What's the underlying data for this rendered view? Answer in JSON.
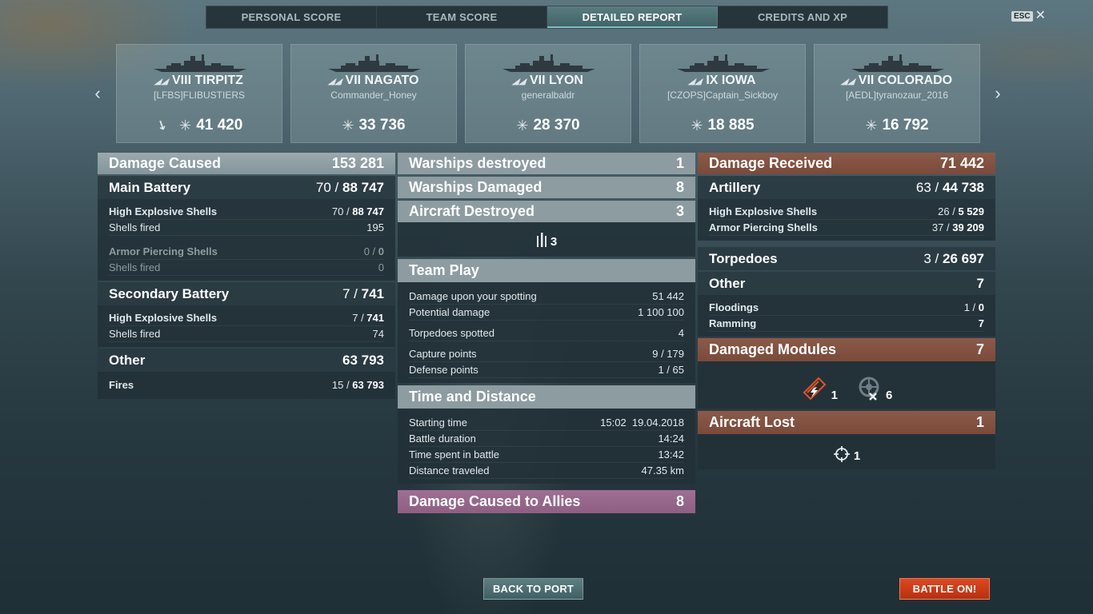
{
  "tabs": [
    {
      "label": "PERSONAL SCORE",
      "active": false
    },
    {
      "label": "TEAM SCORE",
      "active": false
    },
    {
      "label": "DETAILED REPORT",
      "active": true
    },
    {
      "label": "CREDITS AND XP",
      "active": false
    }
  ],
  "esc": {
    "key": "ESC",
    "close": "✕"
  },
  "nav": {
    "prev": "‹",
    "next": "›"
  },
  "ships": [
    {
      "tier": "VIII",
      "name": "TIRPITZ",
      "player": "[LFBS]FLIBUSTIERS",
      "damage": "41 420",
      "sunk": true
    },
    {
      "tier": "VII",
      "name": "NAGATO",
      "player": "Commander_Honey",
      "damage": "33 736",
      "sunk": false
    },
    {
      "tier": "VII",
      "name": "LYON",
      "player": "generalbaldr",
      "damage": "28 370",
      "sunk": false
    },
    {
      "tier": "IX",
      "name": "IOWA",
      "player": "[CZOPS]Captain_Sickboy",
      "damage": "18 885",
      "sunk": false
    },
    {
      "tier": "VII",
      "name": "COLORADO",
      "player": "[AEDL]tyranozaur_2016",
      "damage": "16 792",
      "sunk": false
    }
  ],
  "left": {
    "damage_caused": {
      "label": "Damage Caused",
      "value": "153 281"
    },
    "main_battery": {
      "label": "Main Battery",
      "hits": "70",
      "value": "88 747",
      "he": {
        "label": "High Explosive Shells",
        "hits": "70",
        "value": "88 747"
      },
      "he_fired": {
        "label": "Shells fired",
        "value": "195"
      },
      "ap": {
        "label": "Armor Piercing Shells",
        "hits": "0",
        "value": "0"
      },
      "ap_fired": {
        "label": "Shells fired",
        "value": "0"
      }
    },
    "secondary": {
      "label": "Secondary Battery",
      "hits": "7",
      "value": "741",
      "he": {
        "label": "High Explosive Shells",
        "hits": "7",
        "value": "741"
      },
      "fired": {
        "label": "Shells fired",
        "value": "74"
      }
    },
    "other": {
      "label": "Other",
      "value": "63 793",
      "fires": {
        "label": "Fires",
        "hits": "15",
        "value": "63 793"
      }
    }
  },
  "middle": {
    "destroyed": {
      "label": "Warships destroyed",
      "value": "1"
    },
    "damaged": {
      "label": "Warships Damaged",
      "value": "8"
    },
    "aircraft": {
      "label": "Aircraft Destroyed",
      "value": "3",
      "icon_count": "3"
    },
    "team_play": {
      "label": "Team Play",
      "rows": [
        {
          "label": "Damage upon your spotting",
          "value": "51 442"
        },
        {
          "label": "Potential damage",
          "value": "1 100 100"
        },
        {
          "label": "Torpedoes spotted",
          "value": "4"
        },
        {
          "label": "Capture points",
          "value": "9 / 179"
        },
        {
          "label": "Defense points",
          "value": "1 / 65"
        }
      ]
    },
    "time": {
      "label": "Time and Distance",
      "rows": [
        {
          "label": "Starting time",
          "value": "15:02  19.04.2018"
        },
        {
          "label": "Battle duration",
          "value": "14:24"
        },
        {
          "label": "Time spent in battle",
          "value": "13:42"
        },
        {
          "label": "Distance traveled",
          "value": "47.35 km"
        }
      ]
    },
    "allies": {
      "label": "Damage Caused to Allies",
      "value": "8"
    }
  },
  "right": {
    "received": {
      "label": "Damage Received",
      "value": "71 442"
    },
    "artillery": {
      "label": "Artillery",
      "hits": "63",
      "value": "44 738",
      "he": {
        "label": "High Explosive Shells",
        "hits": "26",
        "value": "5 529"
      },
      "ap": {
        "label": "Armor Piercing Shells",
        "hits": "37",
        "value": "39 209"
      }
    },
    "torpedoes": {
      "label": "Torpedoes",
      "hits": "3",
      "value": "26 697"
    },
    "other": {
      "label": "Other",
      "value": "7",
      "flooding": {
        "label": "Floodings",
        "hits": "1",
        "value": "0"
      },
      "ramming": {
        "label": "Ramming",
        "value": "7"
      }
    },
    "modules": {
      "label": "Damaged Modules",
      "value": "7",
      "engine_count": "1",
      "steering_count": "6"
    },
    "aircraft_lost": {
      "label": "Aircraft Lost",
      "value": "1",
      "icon_count": "1"
    }
  },
  "buttons": {
    "back": "BACK TO PORT",
    "battle": "BATTLE ON!"
  },
  "colors": {
    "accent": "#7fbec0",
    "received": "#7a4a3a",
    "allies": "#8e5f83",
    "battle": "#d23e18"
  },
  "icons": [
    "ship-silhouette-icon",
    "damage-burst-icon",
    "sunk-ship-icon",
    "aircraft-icon",
    "engine-damage-icon",
    "steering-gear-icon",
    "crosshair-icon"
  ]
}
